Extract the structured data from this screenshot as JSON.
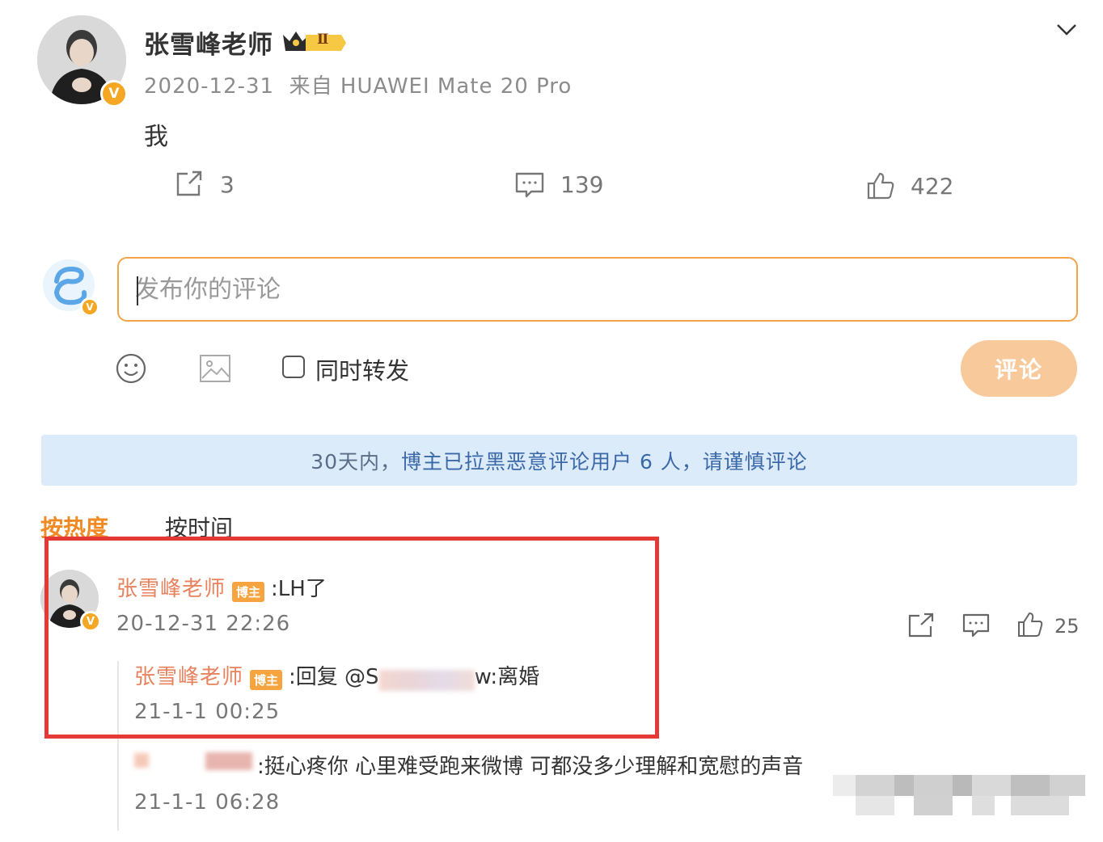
{
  "post": {
    "author": "张雪峰老师",
    "level_badge": "Ⅱ",
    "meta": "2020-12-31  来自 HUAWEI Mate 20 Pro",
    "text": "我",
    "collapse_icon": "chevron-down-icon"
  },
  "actions": {
    "repost_count": "3",
    "comment_count": "139",
    "like_count": "422"
  },
  "composer": {
    "placeholder": "发布你的评论",
    "repost_label": "同时转发",
    "submit_label": "评论"
  },
  "notice": {
    "prefix": "30天内，",
    "highlight": "博主已拉黑恶意评论用户 6 人，请谨慎评论"
  },
  "sort": {
    "hot_label": "按热度",
    "time_label": "按时间"
  },
  "comments": [
    {
      "author": "张雪峰老师",
      "tag": "博主",
      "text": ":LH了",
      "time": "20-12-31 22:26",
      "like_count": "25",
      "replies": [
        {
          "author": "张雪峰老师",
          "tag": "博主",
          "text_before": ":回复 @S",
          "text_after": "w:离婚",
          "time": "21-1-1 00:25"
        },
        {
          "text": ":挺心疼你 心里难受跑来微博 可都没多少理解和宽慰的声音",
          "time": "21-1-1 06:28"
        }
      ]
    }
  ],
  "colors": {
    "accent_orange": "#f3a34a",
    "name_orange": "#e8825d",
    "notice_bg": "#dcebfa",
    "highlight_red": "#e53935"
  }
}
